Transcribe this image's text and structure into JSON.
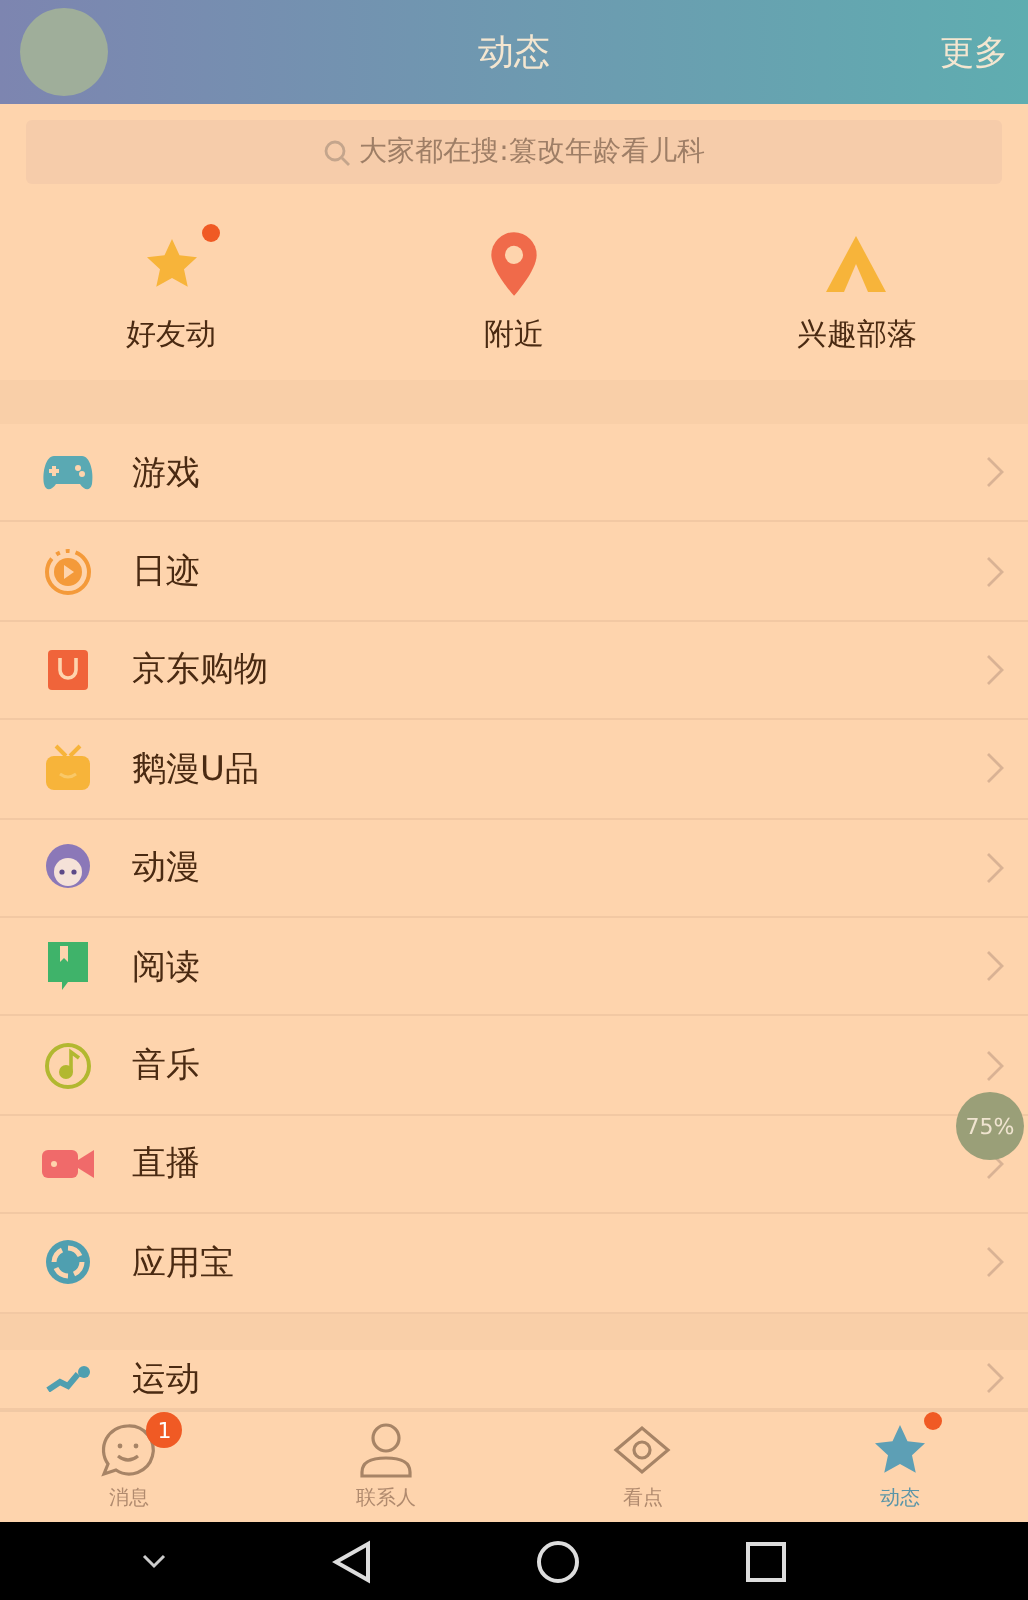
{
  "header": {
    "title": "动态",
    "action": "更多"
  },
  "search": {
    "placeholder": "大家都在搜:篡改年龄看儿科"
  },
  "shortcuts": [
    {
      "kind": "star",
      "label": "好友动",
      "dot": true
    },
    {
      "kind": "pin",
      "label": "附近",
      "dot": false
    },
    {
      "kind": "tent",
      "label": "兴趣部落",
      "dot": false
    }
  ],
  "menu": [
    {
      "kind": "gamepad",
      "label": "游戏"
    },
    {
      "kind": "play",
      "label": "日迹"
    },
    {
      "kind": "bag",
      "label": "京东购物"
    },
    {
      "kind": "tv",
      "label": "鹅漫U品"
    },
    {
      "kind": "face",
      "label": "动漫"
    },
    {
      "kind": "book",
      "label": "阅读"
    },
    {
      "kind": "music",
      "label": "音乐"
    },
    {
      "kind": "camera",
      "label": "直播"
    },
    {
      "kind": "swirl",
      "label": "应用宝"
    }
  ],
  "menu_more": [
    {
      "kind": "runner",
      "label": "运动"
    }
  ],
  "float_badge": "75%",
  "tabs": [
    {
      "kind": "chat",
      "label": "消息",
      "selected": false,
      "badge": "1",
      "dot": false
    },
    {
      "kind": "person",
      "label": "联系人",
      "selected": false,
      "dot": false
    },
    {
      "kind": "eye",
      "label": "看点",
      "selected": false,
      "dot": false
    },
    {
      "kind": "star",
      "label": "动态",
      "selected": true,
      "dot": true
    }
  ]
}
